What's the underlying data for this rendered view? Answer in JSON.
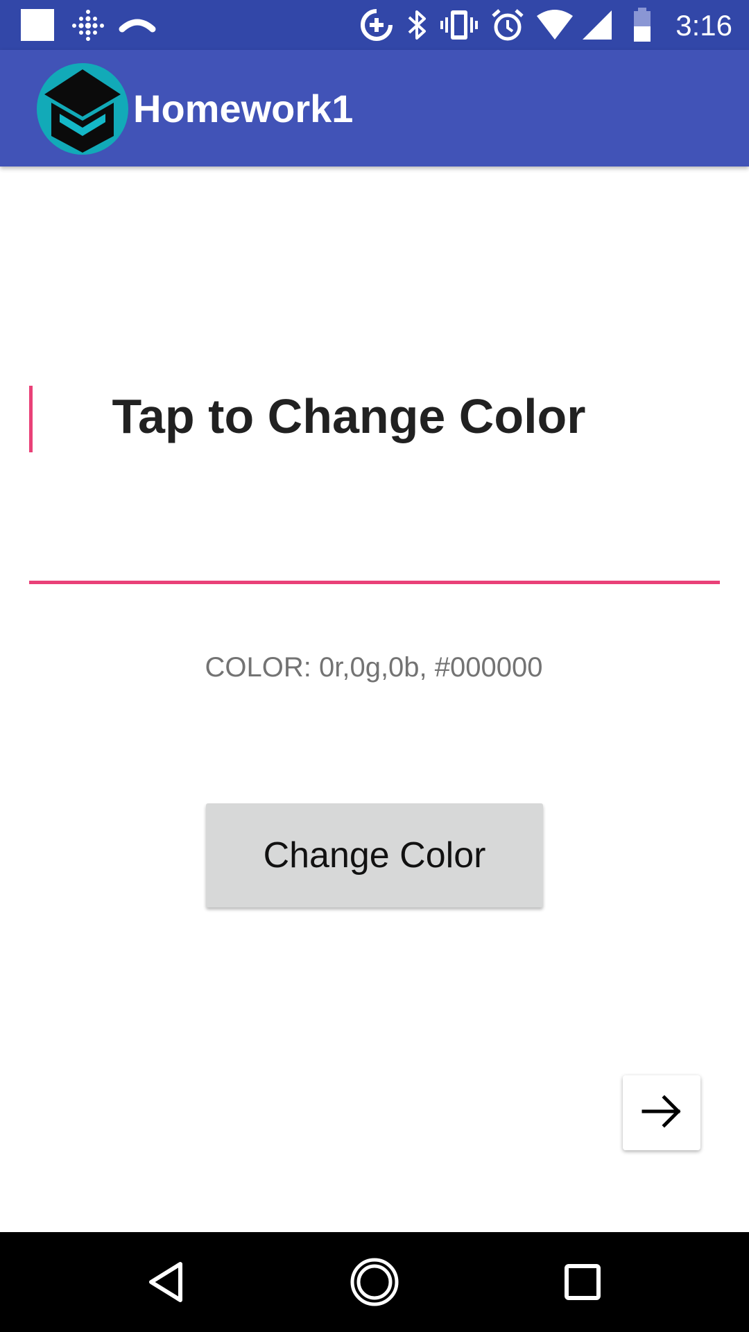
{
  "status_bar": {
    "time": "3:16",
    "icons": [
      "notification-square-icon",
      "fitbit-icon",
      "phone-call-icon",
      "data-saver-icon",
      "bluetooth-icon",
      "vibrate-icon",
      "alarm-icon",
      "wifi-icon",
      "cell-signal-icon",
      "battery-icon"
    ]
  },
  "app_bar": {
    "title": "Homework1",
    "logo_icon": "graduation-cap-logo-icon"
  },
  "main": {
    "input_text": "Tap to Change Color",
    "color_readout": "COLOR: 0r,0g,0b, #000000",
    "change_button_label": "Change Color",
    "next_icon": "arrow-right-icon"
  },
  "nav_bar": {
    "icons": [
      "back-icon",
      "home-icon",
      "recents-icon"
    ]
  },
  "colors": {
    "status_bar": "#3247a8",
    "app_bar": "#4153b7",
    "accent": "#e94178",
    "button": "#d7d8d8",
    "readout_text": "#737373"
  }
}
